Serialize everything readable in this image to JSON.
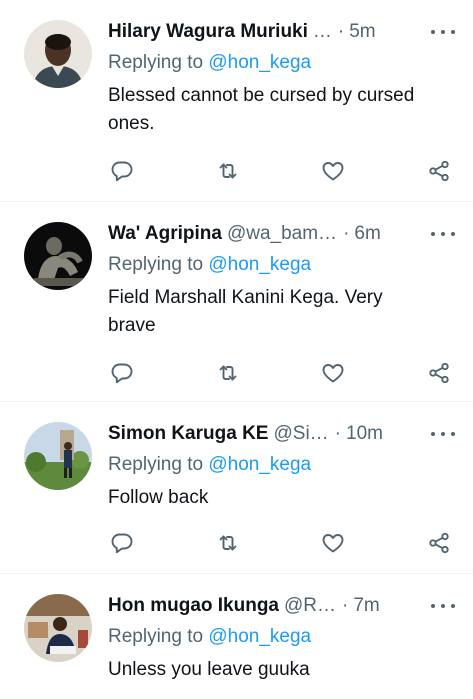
{
  "tweets": [
    {
      "name": "Hilary Wagura Muriuki",
      "handle": "…",
      "dot": "·",
      "time": "5m",
      "replying_prefix": "Replying to",
      "replying_to": "@hon_kega",
      "text": "Blessed cannot be cursed by cursed ones."
    },
    {
      "name": "Wa' Agripina",
      "handle": "@wa_bam…",
      "dot": "·",
      "time": "6m",
      "replying_prefix": "Replying to",
      "replying_to": "@hon_kega",
      "text": "Field Marshall Kanini Kega. Very brave"
    },
    {
      "name": "Simon Karuga KE",
      "handle": "@Si…",
      "dot": "·",
      "time": "10m",
      "replying_prefix": "Replying to",
      "replying_to": "@hon_kega",
      "text": "Follow back"
    },
    {
      "name": "Hon mugao Ikunga",
      "handle": "@R…",
      "dot": "·",
      "time": "7m",
      "replying_prefix": "Replying to",
      "replying_to": "@hon_kega",
      "text": "Unless you leave guuka"
    }
  ],
  "icons": {
    "reply": "reply-icon",
    "retweet": "retweet-icon",
    "like": "heart-icon",
    "share": "share-icon",
    "more": "more-options-icon"
  },
  "colors": {
    "mention": "#1d9bf0",
    "secondary_text": "#536471",
    "divider": "#eff3f4"
  }
}
